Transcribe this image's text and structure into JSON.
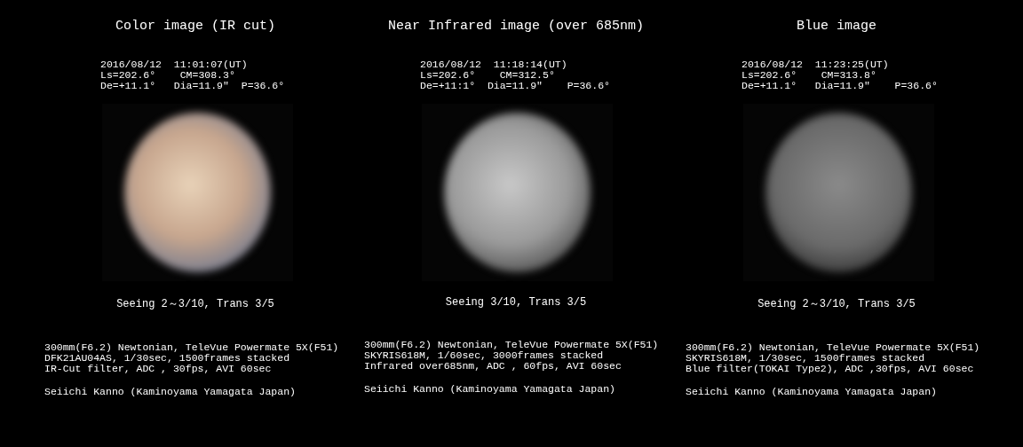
{
  "panels": [
    {
      "title": "Color image (IR cut)",
      "meta": [
        "2016/08/12  11:01:07(UT)",
        "Ls=202.6°    CM=308.3°",
        "De=+11.1°   Dia=11.9″  P=36.6°"
      ],
      "image": {
        "kind": "color"
      },
      "seeing": "Seeing 2～3/10, Trans 3/5",
      "specs": [
        "300mm(F6.2) Newtonian, TeleVue Powermate 5X(F51)",
        "DFK21AU04AS, 1/30sec, 1500frames stacked",
        "IR-Cut filter, ADC , 30fps, AVI 60sec"
      ],
      "author": "Seiichi Kanno (Kaminoyama Yamagata Japan)"
    },
    {
      "title": "Near Infrared image (over 685nm)",
      "meta": [
        "2016/08/12  11:18:14(UT)",
        "Ls=202.6°    CM=312.5°",
        "De=+11:1°  Dia=11.9″    P=36.6°"
      ],
      "image": {
        "kind": "infrared"
      },
      "seeing": "Seeing 3/10, Trans 3/5",
      "specs": [
        "300mm(F6.2) Newtonian, TeleVue Powermate 5X(F51)",
        "SKYRIS618M, 1/60sec, 3000frames stacked",
        "Infrared over685nm, ADC , 60fps, AVI 60sec"
      ],
      "author": "Seiichi Kanno (Kaminoyama Yamagata Japan)"
    },
    {
      "title": "Blue image",
      "meta": [
        "2016/08/12  11:23:25(UT)",
        "Ls=202.6°    CM=313.8°",
        "De=+11.1°   Dia=11.9″    P=36.6°"
      ],
      "image": {
        "kind": "blue"
      },
      "seeing": "Seeing 2～3/10, Trans 3/5",
      "specs": [
        "300mm(F6.2) Newtonian, TeleVue Powermate 5X(F51)",
        "SKYRIS618M, 1/30sec, 1500frames stacked",
        "Blue filter(TOKAI Type2), ADC ,30fps, AVI 60sec"
      ],
      "author": "Seiichi Kanno (Kaminoyama Yamagata Japan)"
    }
  ]
}
